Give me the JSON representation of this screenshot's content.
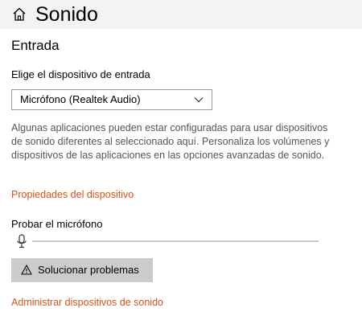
{
  "header": {
    "title": "Sonido",
    "home_icon": "home-icon"
  },
  "section": {
    "title": "Entrada"
  },
  "input_device": {
    "label": "Elige el dispositivo de entrada",
    "selected": "Micrófono (Realtek Audio)",
    "dropdown_icon": "chevron-down-icon"
  },
  "description": "Algunas aplicaciones pueden estar configuradas para usar dispositivos de sonido diferentes al seleccionado aquí. Personaliza los volúmenes y dispositivos de las aplicaciones en las opciones avanzadas de sonido.",
  "links": {
    "device_properties": "Propiedades del dispositivo",
    "manage_devices": "Administrar dispositivos de sonido"
  },
  "mic_test": {
    "label": "Probar el micrófono",
    "icon": "microphone-icon",
    "level": 0
  },
  "troubleshoot": {
    "label": "Solucionar problemas",
    "icon": "warning-icon"
  },
  "colors": {
    "header_bg": "#f3f3f3",
    "link": "#d2521b",
    "button_bg": "#cccccc",
    "description_text": "#555555"
  }
}
